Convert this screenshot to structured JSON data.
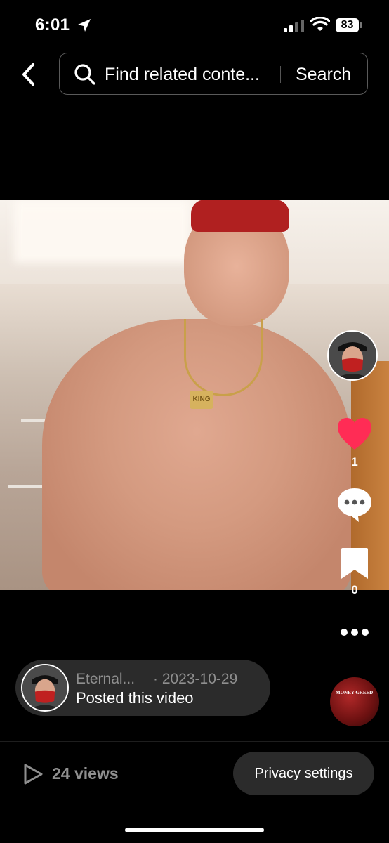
{
  "status_bar": {
    "time": "6:01",
    "battery": "83"
  },
  "search": {
    "placeholder": "Find related conte...",
    "button_label": "Search"
  },
  "video": {
    "pendant_text": "KING"
  },
  "actions": {
    "like_count": "1",
    "save_count": "0",
    "like_color": "#ff2c55"
  },
  "post": {
    "username": "Eternal...",
    "date": "· 2023-10-29",
    "action_text": "Posted this video"
  },
  "music": {
    "disc_label": "MONEY GREED"
  },
  "footer": {
    "views": "24 views",
    "privacy_button": "Privacy settings"
  },
  "icons": [
    "location-arrow-icon",
    "signal-icon",
    "wifi-icon",
    "back-chevron-icon",
    "search-icon",
    "heart-icon",
    "comment-icon",
    "bookmark-icon",
    "more-dots-icon",
    "play-icon"
  ]
}
